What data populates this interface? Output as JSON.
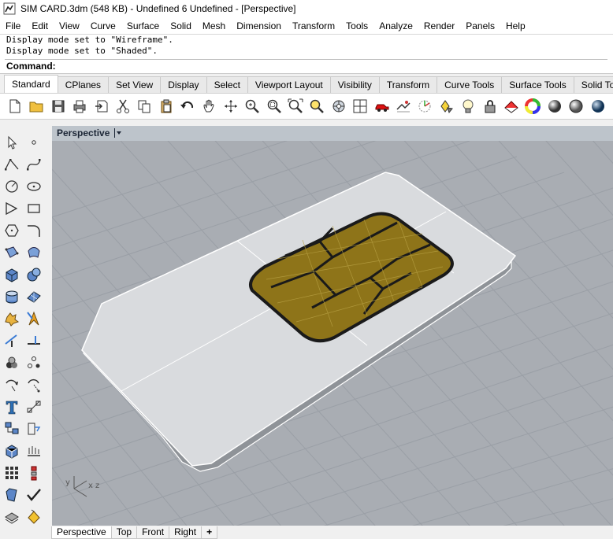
{
  "window": {
    "title": "SIM CARD.3dm (548 KB) - Undefined 6 Undefined - [Perspective]"
  },
  "menubar": {
    "items": [
      "File",
      "Edit",
      "View",
      "Curve",
      "Surface",
      "Solid",
      "Mesh",
      "Dimension",
      "Transform",
      "Tools",
      "Analyze",
      "Render",
      "Panels",
      "Help"
    ]
  },
  "command": {
    "history": [
      "Display mode set to \"Wireframe\".",
      "Display mode set to \"Shaded\"."
    ],
    "prompt_label": "Command:",
    "input_value": ""
  },
  "toolbar_tabs": [
    "Standard",
    "CPlanes",
    "Set View",
    "Display",
    "Select",
    "Viewport Layout",
    "Visibility",
    "Transform",
    "Curve Tools",
    "Surface Tools",
    "Solid To"
  ],
  "toolbar_icons": [
    "new-icon",
    "open-icon",
    "save-icon",
    "print-icon",
    "import-icon",
    "cut-icon",
    "copy-icon",
    "paste-icon",
    "undo-icon",
    "pan-icon",
    "rotate-view-icon",
    "zoom-dynamic-icon",
    "zoom-window-icon",
    "zoom-extents-icon",
    "zoom-selected-icon",
    "viewport-properties-icon",
    "four-viewports-icon",
    "car-icon",
    "named-views-icon",
    "cplane-icon",
    "object-properties-icon",
    "light-icon",
    "lock-icon",
    "render-material-icon",
    "color-wheel-icon",
    "shaded-sphere-icon",
    "rendered-sphere-icon",
    "blue-sphere-icon"
  ],
  "sidebar_icons": [
    "select-arrow-icon",
    "point-icon",
    "polyline-icon",
    "curve-icon",
    "circle-icon",
    "ellipse-icon",
    "arc-icon",
    "rectangle-icon",
    "polygon-icon",
    "fillet-icon",
    "surface-corner-icon",
    "surface-patch-icon",
    "box-icon",
    "sphere-icon",
    "cylinder-icon",
    "mesh-icon",
    "boolean-icon",
    "explode-icon",
    "trim-icon",
    "split-icon",
    "group-icon",
    "array-icon",
    "move-icon",
    "rotate-icon",
    "text-icon",
    "dimension-icon",
    "block-icon",
    "history-icon",
    "cage-icon",
    "layout-icon",
    "grid-icon",
    "record-icon",
    "analyze-icon",
    "check-icon",
    "layer-icon",
    "paint-bucket-icon"
  ],
  "viewport": {
    "title": "Perspective",
    "colors": {
      "background": "#a9adb3",
      "grid": "#9ca1a8",
      "card": "#dfe1e4",
      "chip": "#8e7419",
      "chip_outline": "#1a1a1a"
    },
    "axis_labels": {
      "x": "x",
      "y": "y",
      "z": "z"
    }
  },
  "viewport_tabs": [
    "Perspective",
    "Top",
    "Front",
    "Right",
    "+"
  ]
}
